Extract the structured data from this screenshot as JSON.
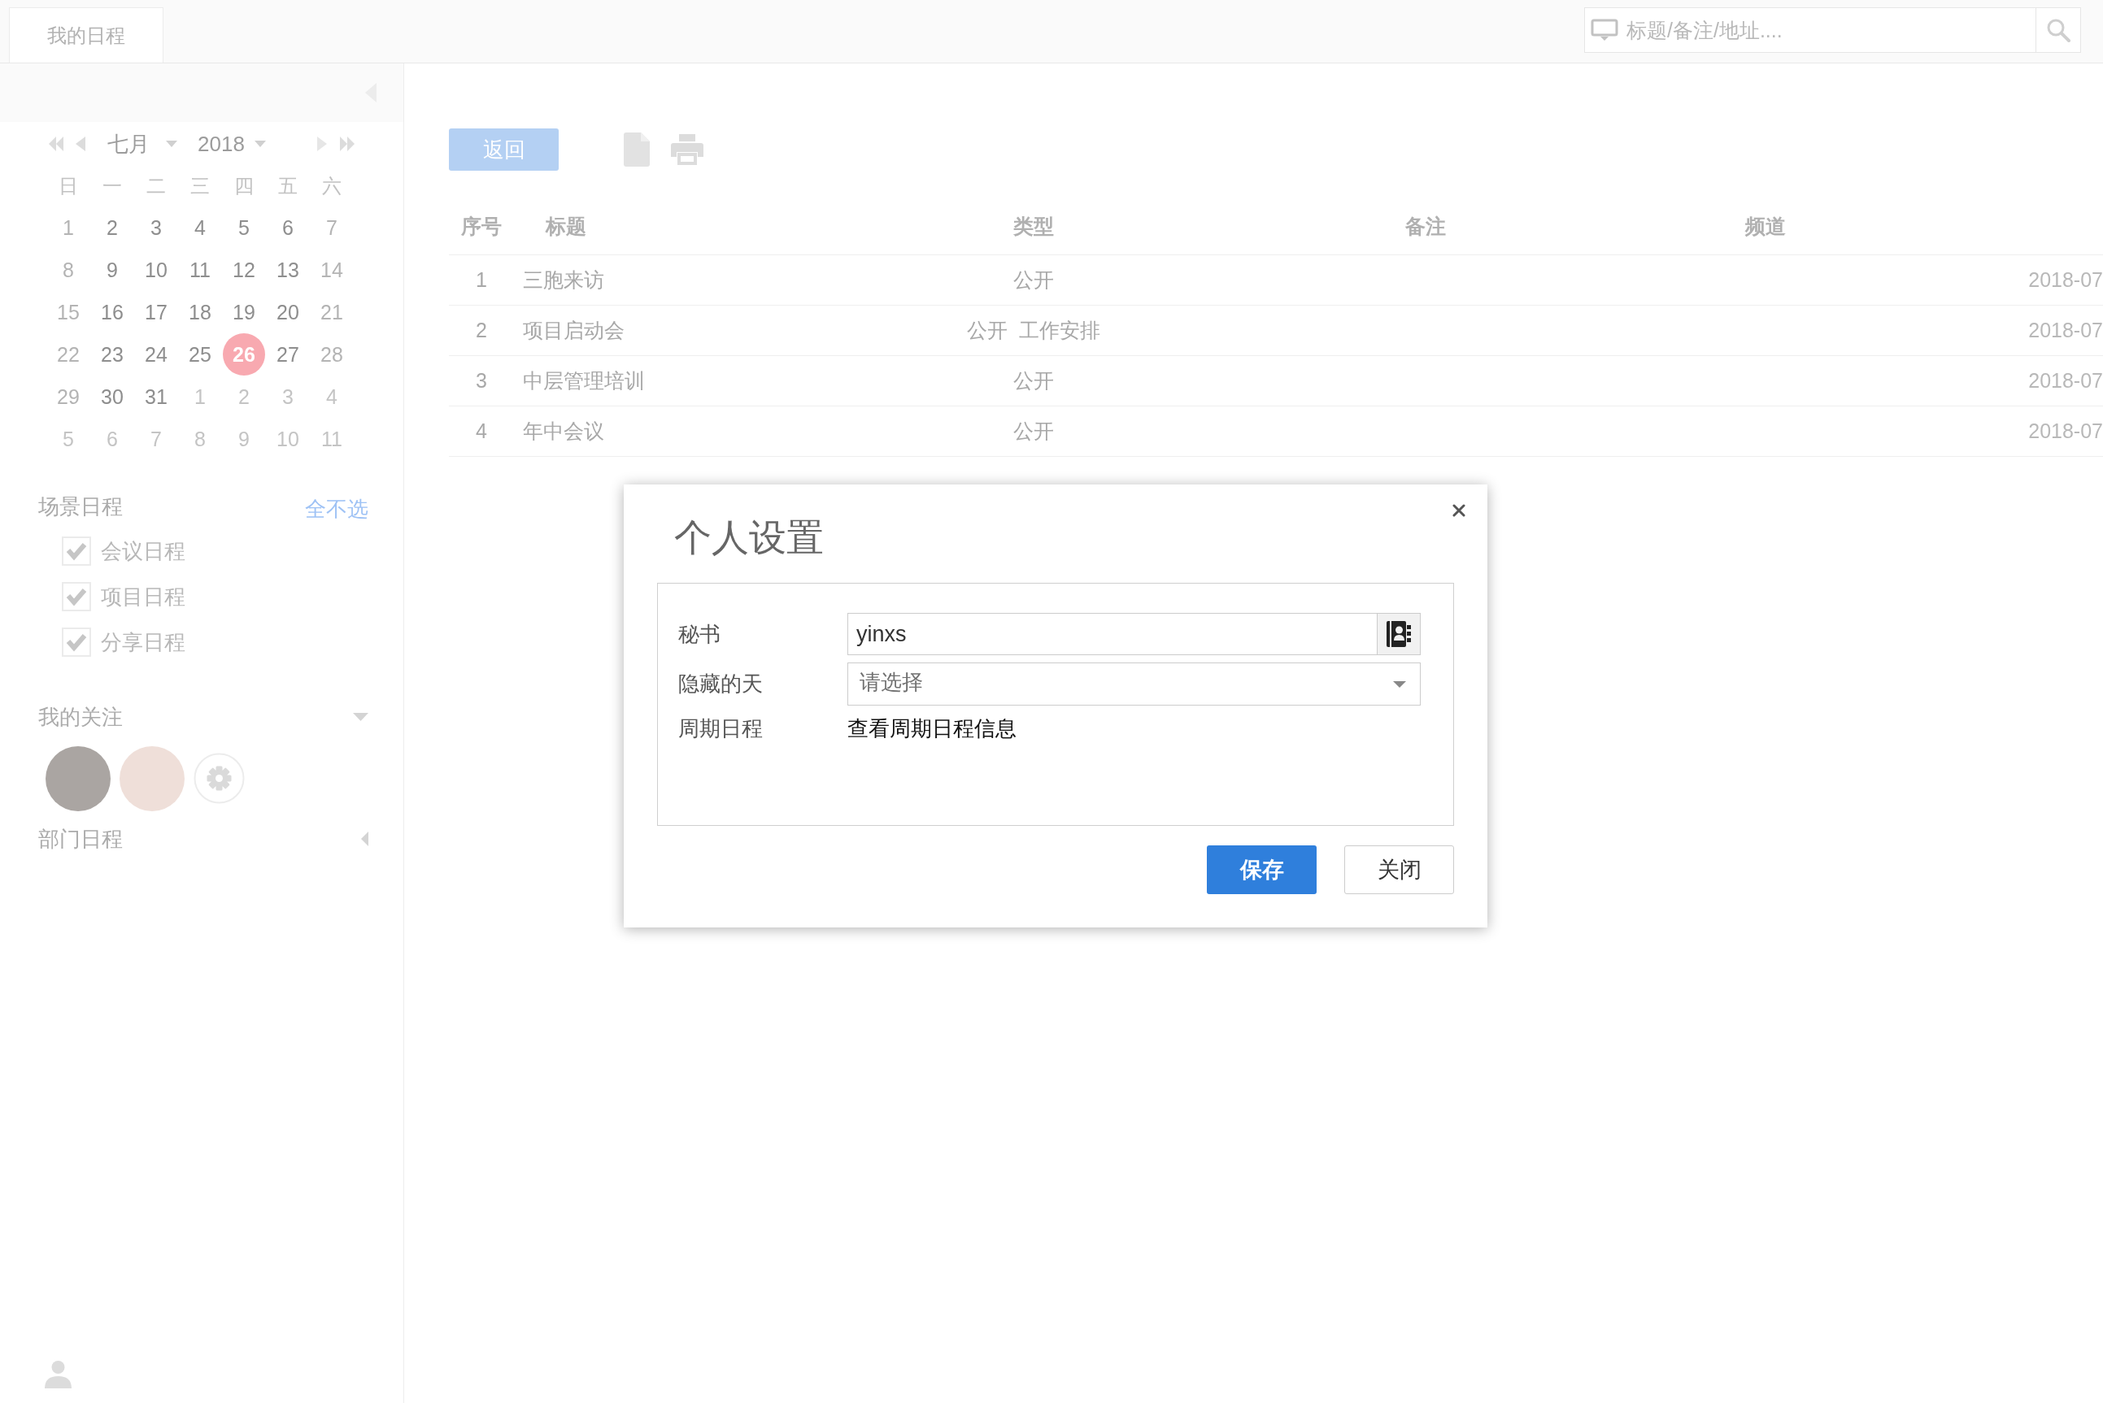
{
  "top_bar": {
    "tabs": [
      {
        "label": "我的日程",
        "selected": true
      }
    ],
    "search": {
      "placeholder": "标题/备注/地址...."
    }
  },
  "sidebar": {
    "calendar": {
      "month": "七月",
      "year": "2018",
      "weekdays": [
        "日",
        "一",
        "二",
        "三",
        "四",
        "五",
        "六"
      ],
      "weeks": [
        [
          {
            "day": "1",
            "kind": "weekend",
            "selected": false
          },
          {
            "day": "2",
            "kind": "weekday",
            "selected": false
          },
          {
            "day": "3",
            "kind": "weekday",
            "selected": false
          },
          {
            "day": "4",
            "kind": "weekday",
            "selected": false
          },
          {
            "day": "5",
            "kind": "weekday",
            "selected": false
          },
          {
            "day": "6",
            "kind": "weekday",
            "selected": false
          },
          {
            "day": "7",
            "kind": "weekend",
            "selected": false
          }
        ],
        [
          {
            "day": "8",
            "kind": "weekend",
            "selected": false
          },
          {
            "day": "9",
            "kind": "weekday",
            "selected": false
          },
          {
            "day": "10",
            "kind": "weekday",
            "selected": false
          },
          {
            "day": "11",
            "kind": "weekday",
            "selected": false
          },
          {
            "day": "12",
            "kind": "weekday",
            "selected": false
          },
          {
            "day": "13",
            "kind": "weekday",
            "selected": false
          },
          {
            "day": "14",
            "kind": "weekend",
            "selected": false
          }
        ],
        [
          {
            "day": "15",
            "kind": "weekend",
            "selected": false
          },
          {
            "day": "16",
            "kind": "weekday",
            "selected": false
          },
          {
            "day": "17",
            "kind": "weekday",
            "selected": false
          },
          {
            "day": "18",
            "kind": "weekday",
            "selected": false
          },
          {
            "day": "19",
            "kind": "weekday",
            "selected": false
          },
          {
            "day": "20",
            "kind": "weekday",
            "selected": false
          },
          {
            "day": "21",
            "kind": "weekend",
            "selected": false
          }
        ],
        [
          {
            "day": "22",
            "kind": "weekend",
            "selected": false
          },
          {
            "day": "23",
            "kind": "weekday",
            "selected": false
          },
          {
            "day": "24",
            "kind": "weekday",
            "selected": false
          },
          {
            "day": "25",
            "kind": "weekday",
            "selected": false
          },
          {
            "day": "26",
            "kind": "weekday",
            "selected": true
          },
          {
            "day": "27",
            "kind": "weekday",
            "selected": false
          },
          {
            "day": "28",
            "kind": "weekend",
            "selected": false
          }
        ],
        [
          {
            "day": "29",
            "kind": "weekend",
            "selected": false
          },
          {
            "day": "30",
            "kind": "weekday",
            "selected": false
          },
          {
            "day": "31",
            "kind": "weekday",
            "selected": false
          },
          {
            "day": "1",
            "kind": "outside",
            "selected": false
          },
          {
            "day": "2",
            "kind": "outside",
            "selected": false
          },
          {
            "day": "3",
            "kind": "outside",
            "selected": false
          },
          {
            "day": "4",
            "kind": "outside",
            "selected": false
          }
        ],
        [
          {
            "day": "5",
            "kind": "outside",
            "selected": false
          },
          {
            "day": "6",
            "kind": "outside",
            "selected": false
          },
          {
            "day": "7",
            "kind": "outside",
            "selected": false
          },
          {
            "day": "8",
            "kind": "outside",
            "selected": false
          },
          {
            "day": "9",
            "kind": "outside",
            "selected": false
          },
          {
            "day": "10",
            "kind": "outside",
            "selected": false
          },
          {
            "day": "11",
            "kind": "outside",
            "selected": false
          }
        ]
      ]
    },
    "scenes": {
      "title": "场景日程",
      "action": "全不选",
      "items": [
        {
          "label": "会议日程",
          "checked": true
        },
        {
          "label": "项目日程",
          "checked": true
        },
        {
          "label": "分享日程",
          "checked": true
        }
      ]
    },
    "following": {
      "title": "我的关注",
      "expanded": true,
      "avatars": [
        {
          "kind": "photo"
        },
        {
          "kind": "photo"
        },
        {
          "kind": "settings"
        }
      ]
    },
    "department": {
      "title": "部门日程",
      "expanded": false
    }
  },
  "toolbar": {
    "back_button": "返回"
  },
  "table": {
    "columns": [
      "序号",
      "标题",
      "类型",
      "备注",
      "频道"
    ],
    "rows": [
      {
        "number": "1",
        "title": "三胞来访",
        "type": "公开",
        "column_6": "2018-07"
      },
      {
        "number": "2",
        "title": "项目启动会",
        "type": "公开  工作安排",
        "column_6": "2018-07"
      },
      {
        "number": "3",
        "title": "中层管理培训",
        "type": "公开",
        "column_6": "2018-07"
      },
      {
        "number": "4",
        "title": "年中会议",
        "type": "公开",
        "column_6": "2018-07"
      }
    ]
  },
  "dialog": {
    "title": "个人设置",
    "fields": [
      {
        "kind": "picker",
        "label": "秘书",
        "value": "yinxs"
      },
      {
        "kind": "select",
        "label": "隐藏的天",
        "placeholder": "请选择"
      },
      {
        "kind": "link",
        "label": "周期日程",
        "link": "查看周期日程信息"
      }
    ],
    "buttons": [
      {
        "kind": "primary",
        "label": "保存"
      },
      {
        "kind": "default",
        "label": "关闭"
      }
    ]
  }
}
